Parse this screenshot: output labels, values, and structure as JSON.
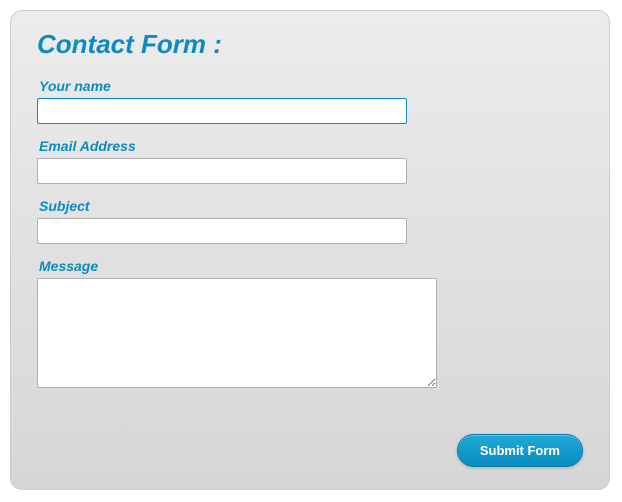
{
  "panel": {
    "title": "Contact Form :"
  },
  "fields": {
    "name": {
      "label": "Your name",
      "value": "",
      "placeholder": ""
    },
    "email": {
      "label": "Email Address",
      "value": "",
      "placeholder": ""
    },
    "subject": {
      "label": "Subject",
      "value": "",
      "placeholder": ""
    },
    "message": {
      "label": "Message",
      "value": "",
      "placeholder": ""
    }
  },
  "submit": {
    "label": "Submit Form"
  },
  "colors": {
    "accent": "#0b8cc0"
  }
}
